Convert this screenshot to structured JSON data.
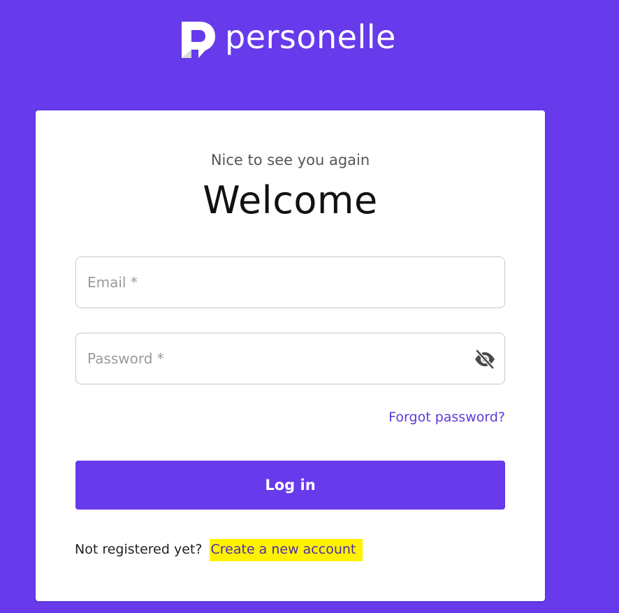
{
  "brand": {
    "name": "personelle"
  },
  "login": {
    "subtitle": "Nice to see you again",
    "title": "Welcome",
    "email_placeholder": "Email *",
    "email_value": "",
    "password_placeholder": "Password *",
    "password_value": "",
    "password_toggle_icon": "eye-off-icon",
    "forgot_password": "Forgot password?",
    "login_button": "Log in",
    "register_prompt": "Not registered yet?",
    "create_account": "Create a new account"
  },
  "colors": {
    "background": "#673aec",
    "accent": "#673aec",
    "link": "#5c39d9",
    "highlight": "#fff200"
  }
}
